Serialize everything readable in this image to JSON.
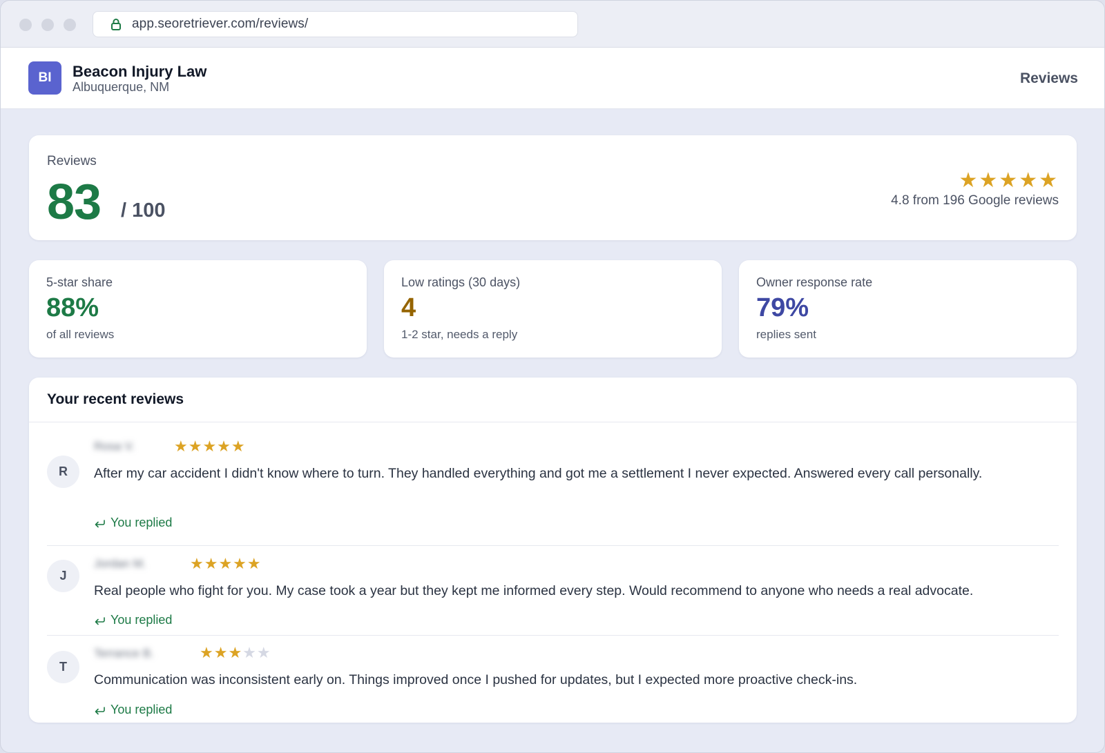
{
  "browser": {
    "url": "app.seoretriever.com/reviews/"
  },
  "header": {
    "logo_initials": "BI",
    "business_name": "Beacon Injury Law",
    "location": "Albuquerque, NM",
    "nav_label": "Reviews"
  },
  "score_card": {
    "label": "Reviews",
    "score": "83",
    "max": "/ 100",
    "rating": 4.8,
    "stars": "★★★★★",
    "summary": "4.8 from 196 Google reviews"
  },
  "stats": [
    {
      "label": "5-star share",
      "value": "88%",
      "sub": "of all reviews",
      "color": "#1d7a46"
    },
    {
      "label": "Low ratings (30 days)",
      "value": "4",
      "sub": "1-2 star, needs a reply",
      "color": "#956400"
    },
    {
      "label": "Owner response rate",
      "value": "79%",
      "sub": "replies sent",
      "color": "#3e48a3"
    }
  ],
  "recent_reviews": {
    "title": "Your recent reviews",
    "items": [
      {
        "initial": "R",
        "name": "Rosa V.",
        "rating": 5,
        "stars_on": "★★★★★",
        "stars_off": "",
        "text": "After my car accident I didn't know where to turn. They handled everything and got me a settlement I never expected. Answered every call personally.",
        "reply_status": "You replied"
      },
      {
        "initial": "J",
        "name": "Jordan M.",
        "rating": 5,
        "stars_on": "★★★★★",
        "stars_off": "",
        "text": "Real people who fight for you. My case took a year but they kept me informed every step. Would recommend to anyone who needs a real advocate.",
        "reply_status": "You replied"
      },
      {
        "initial": "T",
        "name": "Terrance B.",
        "rating": 3,
        "stars_on": "★★★",
        "stars_off": "★★",
        "text": "Communication was inconsistent early on. Things improved once I pushed for updates, but I expected more proactive check-ins.",
        "reply_status": "You replied"
      }
    ]
  },
  "colors": {
    "accent": "#5a63cf",
    "star": "#dca324",
    "positive": "#1d7a46"
  }
}
